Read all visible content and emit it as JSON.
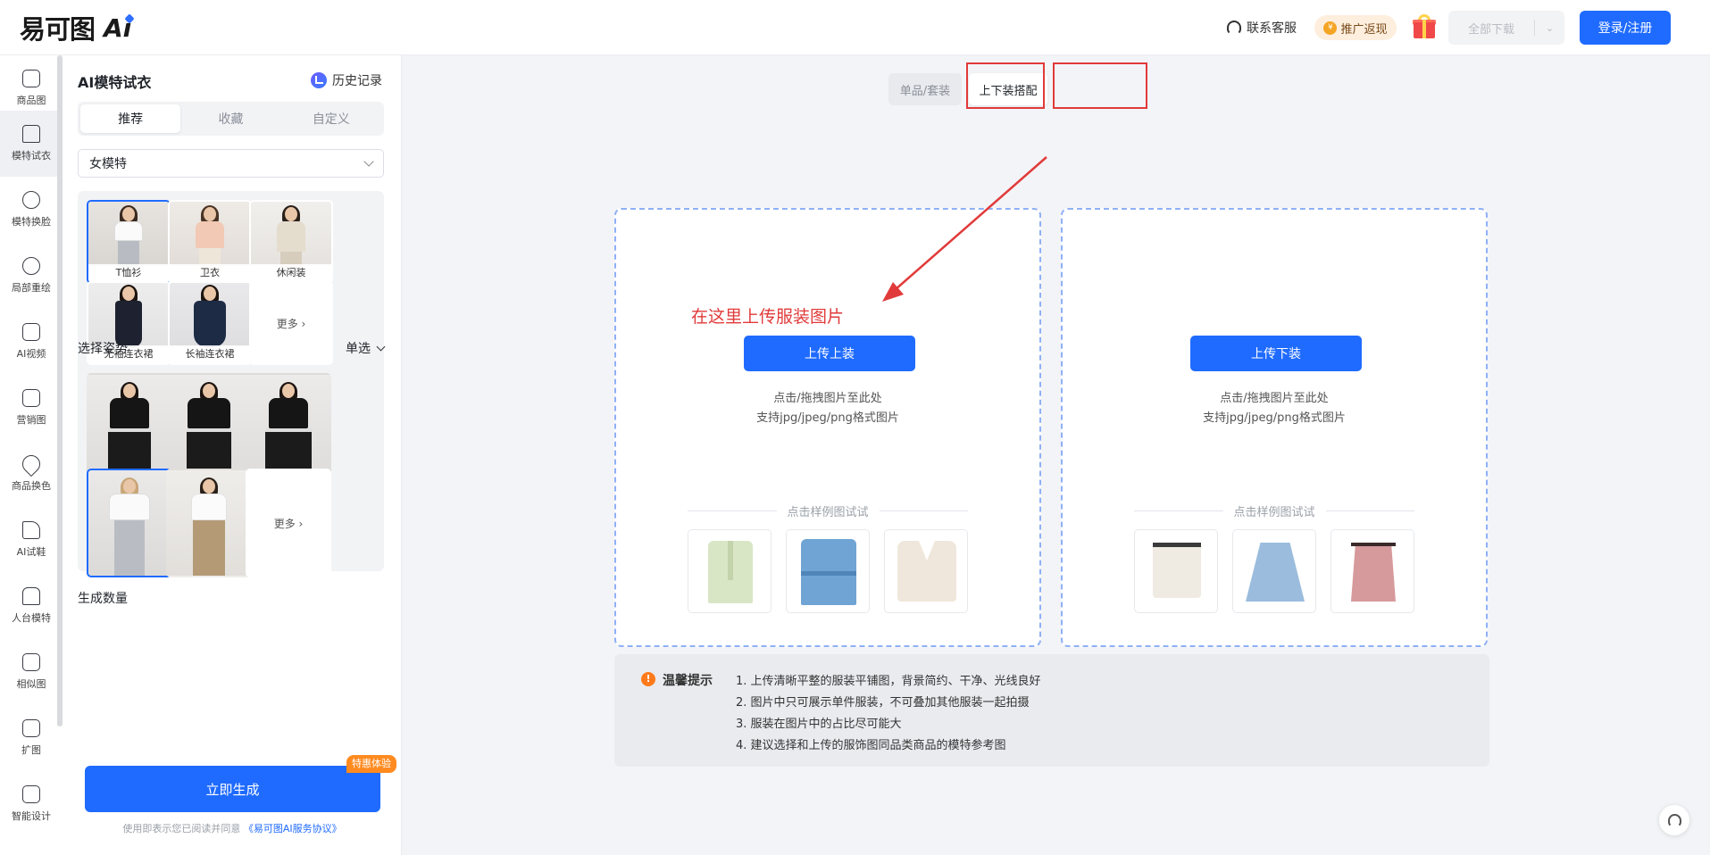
{
  "header": {
    "logo_text": "易可图",
    "logo_ai": "Ai",
    "service_label": "联系客服",
    "promo_label": "推广返现",
    "download_label": "全部下载",
    "login_label": "登录/注册"
  },
  "nav": {
    "items": [
      {
        "label": "商品图",
        "icon": "image-icon"
      },
      {
        "label": "模特试衣",
        "icon": "shirt-icon"
      },
      {
        "label": "模特换脸",
        "icon": "face-icon"
      },
      {
        "label": "局部重绘",
        "icon": "face-swap-icon"
      },
      {
        "label": "AI视频",
        "icon": "video-icon"
      },
      {
        "label": "营销图",
        "icon": "document-icon"
      },
      {
        "label": "商品换色",
        "icon": "drop-icon"
      },
      {
        "label": "AI试鞋",
        "icon": "shoe-icon"
      },
      {
        "label": "人台模特",
        "icon": "mannequin-icon"
      },
      {
        "label": "相似图",
        "icon": "similar-icon"
      },
      {
        "label": "扩图",
        "icon": "expand-icon"
      },
      {
        "label": "智能设计",
        "icon": "design-icon"
      }
    ],
    "active_index": 1
  },
  "panel": {
    "title": "AI模特试衣",
    "history_label": "历史记录",
    "tabs": [
      {
        "label": "推荐",
        "active": true
      },
      {
        "label": "收藏",
        "active": false
      },
      {
        "label": "自定义",
        "active": false
      }
    ],
    "model_select": "女模特",
    "models": [
      {
        "label": "T恤衫",
        "selected": true
      },
      {
        "label": "卫衣",
        "selected": false
      },
      {
        "label": "休闲装",
        "selected": false
      },
      {
        "label": "无袖连衣裙",
        "selected": false
      },
      {
        "label": "长袖连衣裙",
        "selected": false
      }
    ],
    "models_more": "更多 ›",
    "pose_label": "选择姿势",
    "pose_mode": "单选",
    "poses_more": "更多 ›",
    "pose_selected_index": 3,
    "quantity_label": "生成数量",
    "generate_label": "立即生成",
    "generate_badge": "特惠体验",
    "agree_prefix": "使用即表示您已阅读并同意",
    "agree_link": "《易可图AI服务协议》"
  },
  "main": {
    "mode_tabs": [
      {
        "label": "单品/套装",
        "active": false
      },
      {
        "label": "上下装搭配",
        "active": true
      }
    ],
    "annotation": "在这里上传服装图片",
    "upload_top": {
      "button": "上传上装",
      "hint1": "点击/拖拽图片至此处",
      "hint2": "支持jpg/jpeg/png格式图片",
      "sample_label": "点击样例图试试"
    },
    "upload_bottom": {
      "button": "上传下装",
      "hint1": "点击/拖拽图片至此处",
      "hint2": "支持jpg/jpeg/png格式图片",
      "sample_label": "点击样例图试试"
    },
    "tips": {
      "title": "温馨提示",
      "lines": [
        "1. 上传清晰平整的服装平铺图，背景简约、干净、光线良好",
        "2. 图片中只可展示单件服装，不可叠加其他服装一起拍摄",
        "3. 服装在图片中的占比尽可能大",
        "4. 建议选择和上传的服饰图同品类商品的模特参考图"
      ]
    }
  },
  "colors": {
    "accent": "#1f6bff",
    "annotation_red": "#e13a3a",
    "badge_orange": "#ff8a1f"
  }
}
